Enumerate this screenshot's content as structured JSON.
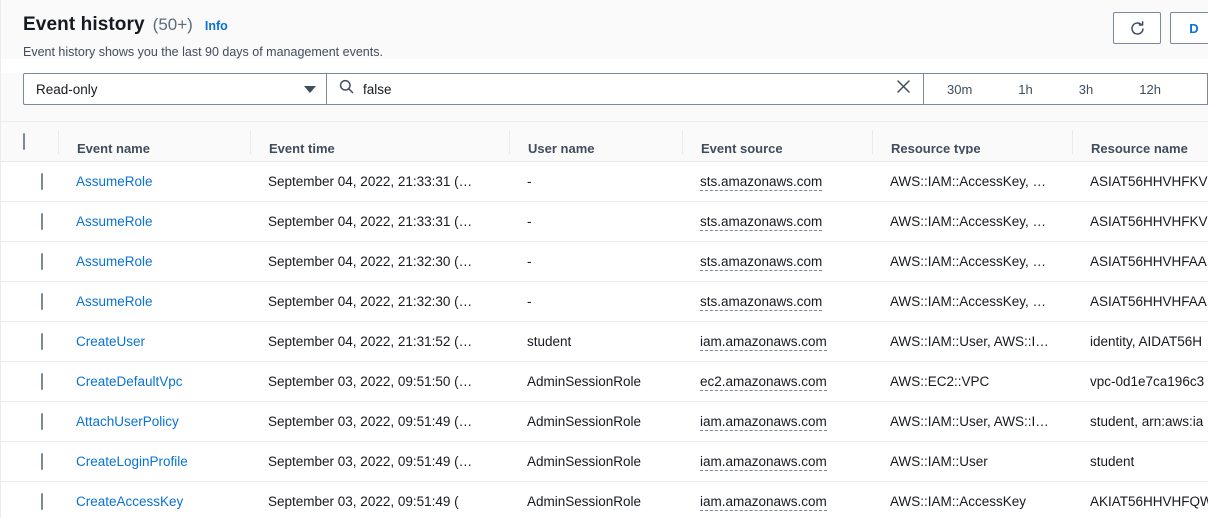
{
  "header": {
    "title": "Event history",
    "count": "(50+)",
    "info_label": "Info",
    "subtitle": "Event history shows you the last 90 days of management events.",
    "refresh_icon": "refresh-icon",
    "download_label": "D"
  },
  "filters": {
    "attribute_selected": "Read-only",
    "search_icon": "search-icon",
    "search_value": "false",
    "clear_icon": "close-icon",
    "time_ranges": [
      "30m",
      "1h",
      "3h",
      "12h"
    ]
  },
  "table": {
    "columns": [
      "Event name",
      "Event time",
      "User name",
      "Event source",
      "Resource type",
      "Resource name"
    ],
    "rows": [
      {
        "event_name": "AssumeRole",
        "event_time": "September 04, 2022, 21:33:31 (…",
        "user_name": "-",
        "event_source": "sts.amazonaws.com",
        "resource_type": "AWS::IAM::AccessKey, …",
        "resource_name": "ASIAT56HHVHFKV"
      },
      {
        "event_name": "AssumeRole",
        "event_time": "September 04, 2022, 21:33:31 (…",
        "user_name": "-",
        "event_source": "sts.amazonaws.com",
        "resource_type": "AWS::IAM::AccessKey, …",
        "resource_name": "ASIAT56HHVHFKV"
      },
      {
        "event_name": "AssumeRole",
        "event_time": "September 04, 2022, 21:32:30 (…",
        "user_name": "-",
        "event_source": "sts.amazonaws.com",
        "resource_type": "AWS::IAM::AccessKey, …",
        "resource_name": "ASIAT56HHVHFAA"
      },
      {
        "event_name": "AssumeRole",
        "event_time": "September 04, 2022, 21:32:30 (…",
        "user_name": "-",
        "event_source": "sts.amazonaws.com",
        "resource_type": "AWS::IAM::AccessKey, …",
        "resource_name": "ASIAT56HHVHFAA"
      },
      {
        "event_name": "CreateUser",
        "event_time": "September 04, 2022, 21:31:52 (…",
        "user_name": "student",
        "event_source": "iam.amazonaws.com",
        "resource_type": "AWS::IAM::User, AWS::I…",
        "resource_name": "identity, AIDAT56H"
      },
      {
        "event_name": "CreateDefaultVpc",
        "event_time": "September 03, 2022, 09:51:50 (…",
        "user_name": "AdminSessionRole",
        "event_source": "ec2.amazonaws.com",
        "resource_type": "AWS::EC2::VPC",
        "resource_name": "vpc-0d1e7ca196c3"
      },
      {
        "event_name": "AttachUserPolicy",
        "event_time": "September 03, 2022, 09:51:49 (…",
        "user_name": "AdminSessionRole",
        "event_source": "iam.amazonaws.com",
        "resource_type": "AWS::IAM::User, AWS::I…",
        "resource_name": "student, arn:aws:ia"
      },
      {
        "event_name": "CreateLoginProfile",
        "event_time": "September 03, 2022, 09:51:49 (…",
        "user_name": "AdminSessionRole",
        "event_source": "iam.amazonaws.com",
        "resource_type": "AWS::IAM::User",
        "resource_name": "student"
      },
      {
        "event_name": "CreateAccessKey",
        "event_time": "September 03, 2022, 09:51:49 (",
        "user_name": "AdminSessionRole",
        "event_source": "iam.amazonaws.com",
        "resource_type": "AWS::IAM::AccessKey",
        "resource_name": "AKIAT56HHVHFQW"
      }
    ]
  },
  "colors": {
    "link": "#0972d3",
    "text": "#16191f",
    "muted": "#5f6b7a",
    "border": "#e9ebed",
    "panel_bg": "#fafafa"
  }
}
